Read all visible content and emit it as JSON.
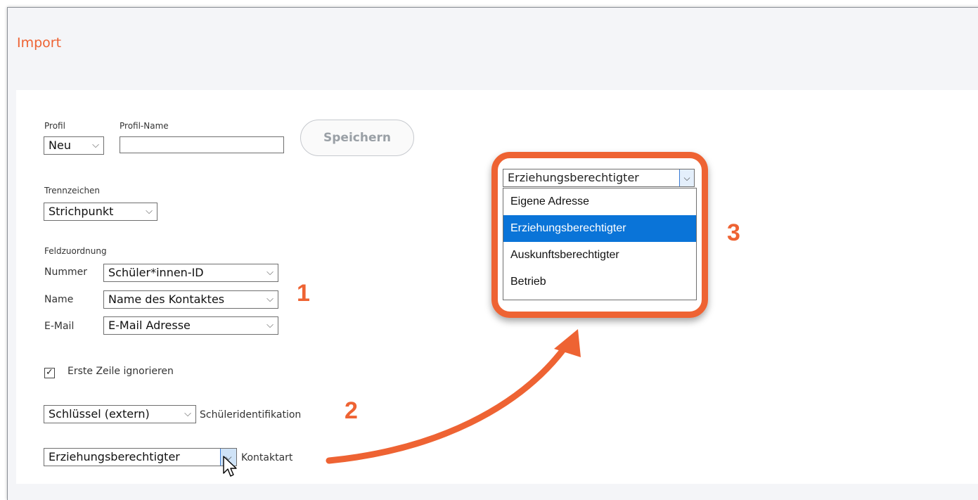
{
  "page": {
    "title": "Import"
  },
  "profile": {
    "profil_label": "Profil",
    "profil_value": "Neu",
    "profilname_label": "Profil-Name",
    "profilname_value": "",
    "save_label": "Speichern"
  },
  "separator": {
    "label": "Trennzeichen",
    "value": "Strichpunkt"
  },
  "mapping": {
    "label": "Feldzuordnung",
    "rows": [
      {
        "label": "Nummer",
        "value": "Schüler*innen-ID"
      },
      {
        "label": "Name",
        "value": "Name des Kontaktes"
      },
      {
        "label": "E-Mail",
        "value": "E-Mail Adresse"
      }
    ]
  },
  "ignore_first_row": {
    "label": "Erste Zeile ignorieren",
    "checked": true
  },
  "key": {
    "value": "Schlüssel (extern)",
    "label": "Schüleridentifikation"
  },
  "contact_type": {
    "value": "Erziehungsberechtigter",
    "label": "Kontaktart"
  },
  "dropdown": {
    "selected": "Erziehungsberechtigter",
    "options": [
      "Eigene Adresse",
      "Erziehungsberechtigter",
      "Auskunftsberechtigter",
      "Betrieb"
    ],
    "highlighted_index": 1
  },
  "annotations": {
    "step1": "1",
    "step2": "2",
    "step3": "3",
    "color": "#ee6333"
  },
  "icons": {
    "chevron": "chevron-down-icon",
    "checkmark": "checkmark-icon",
    "cursor": "mouse-pointer-icon",
    "arrow": "curved-arrow-icon"
  }
}
